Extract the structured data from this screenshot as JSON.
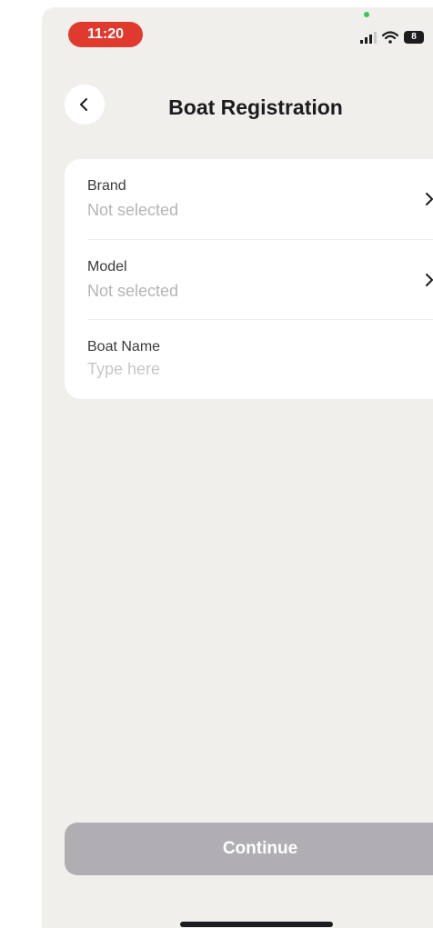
{
  "status_bar": {
    "time": "11:20",
    "battery": "8",
    "icons": [
      "signal-icon",
      "wifi-icon",
      "battery-icon"
    ]
  },
  "header": {
    "title": "Boat Registration",
    "back_icon": "chevron-left-icon"
  },
  "form": {
    "brand": {
      "label": "Brand",
      "value": "Not selected"
    },
    "model": {
      "label": "Model",
      "value": "Not selected"
    },
    "boat_name": {
      "label": "Boat Name",
      "placeholder": "Type here",
      "value": ""
    }
  },
  "footer": {
    "continue_label": "Continue"
  },
  "colors": {
    "background": "#f1efec",
    "card": "#ffffff",
    "time_pill": "#e03a2f",
    "button_disabled": "#b0aeb2",
    "placeholder": "#b5b5b8"
  }
}
